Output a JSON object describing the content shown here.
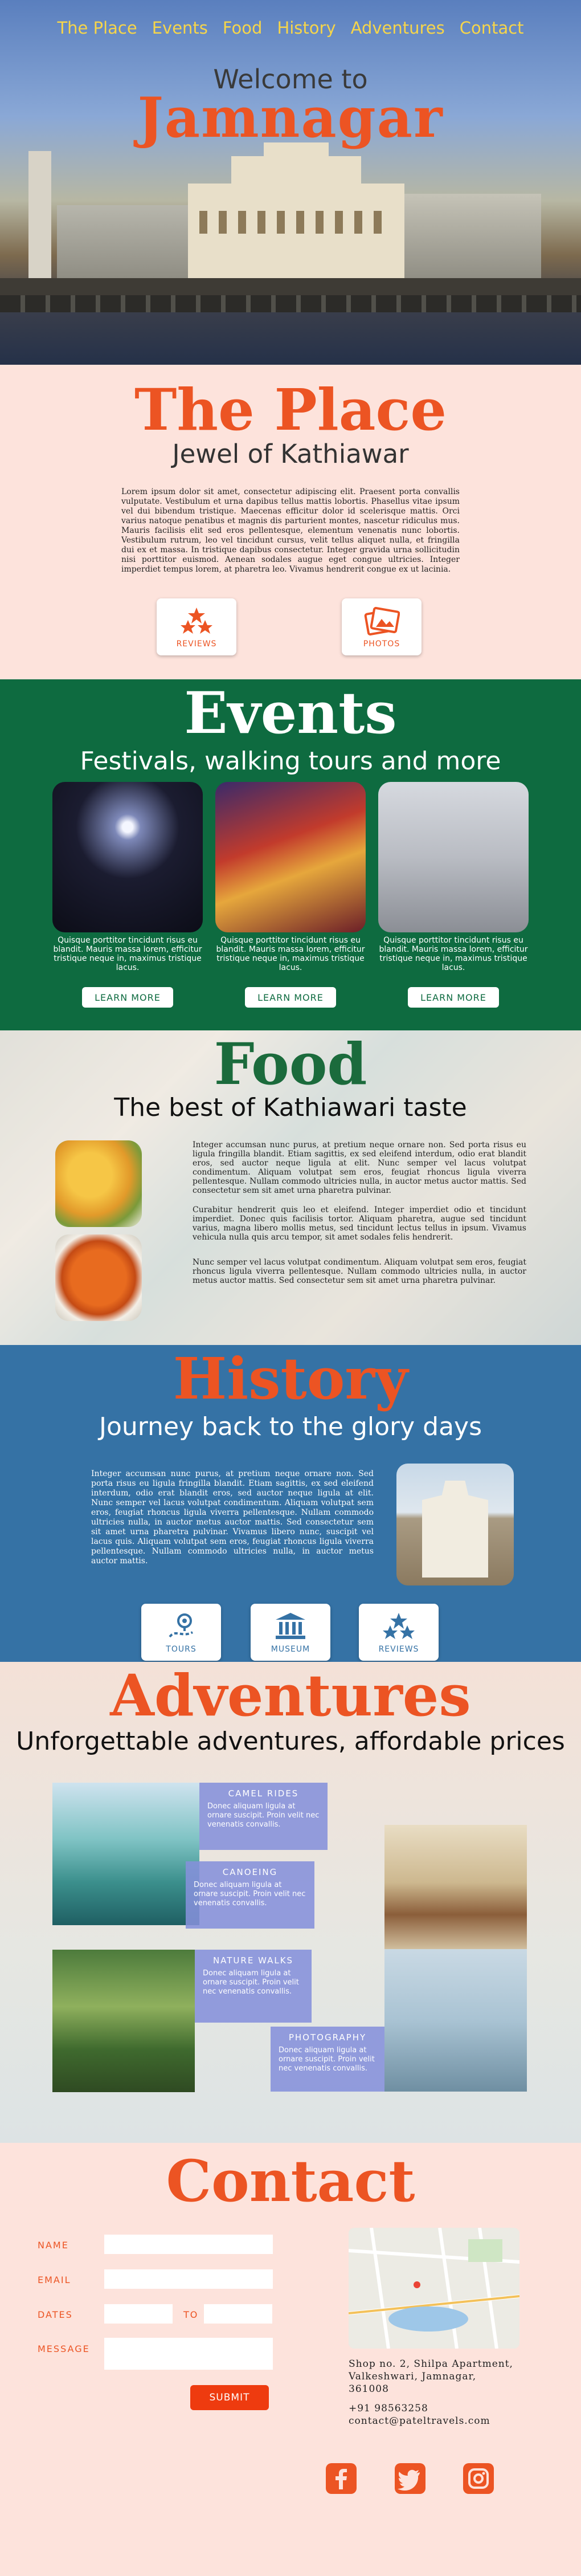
{
  "nav": [
    "The Place",
    "Events",
    "Food",
    "History",
    "Adventures",
    "Contact"
  ],
  "hero": {
    "welcome": "Welcome to",
    "title": "Jamnagar"
  },
  "place": {
    "title": "The Place",
    "subtitle": "Jewel of Kathiawar",
    "body": "Lorem ipsum dolor sit amet, consectetur adipiscing elit. Praesent porta convallis vulputate. Vestibulum et urna dapibus tellus mattis lobortis. Phasellus vitae ipsum vel dui bibendum tristique. Maecenas efficitur dolor id scelerisque mattis. Orci varius natoque penatibus et magnis dis parturient montes, nascetur ridiculus mus. Mauris facilisis elit sed eros pellentesque, elementum venenatis nunc lobortis. Vestibulum rutrum, leo vel tincidunt cursus, velit tellus aliquet nulla, et fringilla dui ex et massa. In tristique dapibus consectetur. Integer gravida urna sollicitudin nisi porttitor euismod. Aenean sodales augue eget congue ultricies. Integer imperdiet tempus lorem, at pharetra leo. Vivamus hendrerit congue ex ut lacinia.",
    "buttons": [
      "REVIEWS",
      "PHOTOS"
    ]
  },
  "events": {
    "title": "Events",
    "subtitle": "Festivals, walking tours and more",
    "cards": [
      {
        "text": "Quisque porttitor tincidunt risus eu blandit. Mauris massa lorem, efficitur tristique neque in, maximus tristique lacus.",
        "button": "LEARN MORE"
      },
      {
        "text": "Quisque porttitor tincidunt risus eu blandit. Mauris massa lorem, efficitur tristique neque in, maximus tristique lacus.",
        "button": "LEARN MORE"
      },
      {
        "text": "Quisque porttitor tincidunt risus eu blandit. Mauris massa lorem, efficitur tristique neque in, maximus tristique lacus.",
        "button": "LEARN MORE"
      }
    ]
  },
  "food": {
    "title": "Food",
    "subtitle": "The best of Kathiawari taste",
    "paragraphs": [
      "Integer accumsan nunc purus, at pretium neque ornare non. Sed porta risus eu ligula fringilla blandit. Etiam sagittis, ex sed eleifend interdum, odio erat blandit eros, sed auctor neque ligula at elit. Nunc semper vel lacus volutpat condimentum. Aliquam volutpat sem eros, feugiat rhoncus ligula viverra pellentesque. Nullam commodo ultricies nulla, in auctor metus auctor mattis. Sed consectetur sem sit amet urna pharetra pulvinar.",
      "Curabitur hendrerit quis leo et eleifend. Integer imperdiet odio et tincidunt imperdiet. Donec quis facilisis tortor. Aliquam pharetra, augue sed tincidunt varius, magna libero mollis metus, sed tincidunt lectus tellus in ipsum. Vivamus vehicula nulla quis arcu tempor, sit amet sodales felis hendrerit.",
      "Nunc semper vel lacus volutpat condimentum. Aliquam volutpat sem eros, feugiat rhoncus ligula viverra pellentesque. Nullam commodo ultricies nulla, in auctor metus auctor mattis. Sed consectetur sem sit amet urna pharetra pulvinar."
    ]
  },
  "history": {
    "title": "History",
    "subtitle": "Journey back to the glory days",
    "body": "Integer accumsan nunc purus, at pretium neque ornare non. Sed porta risus eu ligula fringilla blandit. Etiam sagittis, ex sed eleifend interdum, odio erat blandit eros, sed auctor neque ligula at elit. Nunc semper vel lacus volutpat condimentum. Aliquam volutpat sem eros, feugiat rhoncus ligula viverra pellentesque. Nullam commodo ultricies nulla, in auctor metus auctor mattis. Sed consectetur sem sit amet urna pharetra pulvinar. Vivamus libero nunc, suscipit vel lacus quis. Aliquam volutpat sem eros, feugiat rhoncus ligula viverra pellentesque. Nullam commodo ultricies nulla, in auctor metus auctor mattis.",
    "buttons": [
      "TOURS",
      "MUSEUM",
      "REVIEWS"
    ]
  },
  "adventures": {
    "title": "Adventures",
    "subtitle": "Unforgettable adventures, affordable prices",
    "items": [
      {
        "title": "CAMEL RIDES",
        "text": "Donec aliquam ligula at ornare suscipit. Proin velit nec venenatis convallis."
      },
      {
        "title": "CANOEING",
        "text": "Donec aliquam ligula at ornare suscipit. Proin velit nec venenatis convallis."
      },
      {
        "title": "NATURE WALKS",
        "text": "Donec aliquam ligula at ornare suscipit. Proin velit nec venenatis convallis."
      },
      {
        "title": "PHOTOGRAPHY",
        "text": "Donec aliquam ligula at ornare suscipit. Proin velit nec venenatis convallis."
      }
    ]
  },
  "contact": {
    "title": "Contact",
    "labels": {
      "name": "NAME",
      "email": "EMAIL",
      "dates": "DATES",
      "to": "TO",
      "message": "MESSAGE"
    },
    "submit": "SUBMIT",
    "address": [
      "Shop no. 2, Shilpa Apartment,",
      "Valkeshwari, Jamnagar,",
      "361008"
    ],
    "phone": "+91 98563258",
    "email": "contact@pateltravels.com",
    "social": [
      "facebook-icon",
      "twitter-icon",
      "instagram-icon"
    ]
  },
  "colors": {
    "accent": "#ec5423",
    "green": "#0e6b40",
    "blue": "#3572a5",
    "nav": "#f6d54a",
    "pink": "#fde3dc"
  }
}
